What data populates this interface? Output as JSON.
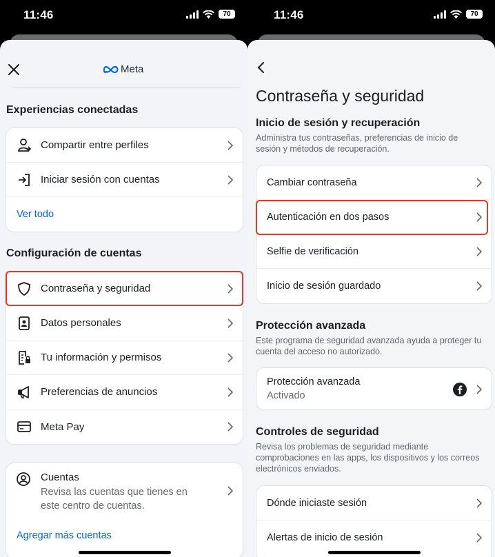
{
  "status": {
    "time": "11:46",
    "battery": "70"
  },
  "left": {
    "brand": "Meta",
    "connected": {
      "title": "Experiencias conectadas",
      "items": [
        {
          "label": "Compartir entre perfiles",
          "icon": "share-profiles-icon"
        },
        {
          "label": "Iniciar sesión con cuentas",
          "icon": "login-arrow-icon"
        }
      ],
      "see_all": "Ver todo"
    },
    "account_settings": {
      "title": "Configuración de cuentas",
      "items": [
        {
          "label": "Contraseña y seguridad",
          "icon": "shield-icon"
        },
        {
          "label": "Datos personales",
          "icon": "id-card-icon"
        },
        {
          "label": "Tu información y permisos",
          "icon": "document-lock-icon"
        },
        {
          "label": "Preferencias de anuncios",
          "icon": "megaphone-icon"
        },
        {
          "label": "Meta Pay",
          "icon": "credit-card-icon"
        }
      ]
    },
    "accounts": {
      "title": "Cuentas",
      "description_line1": "Revisa las cuentas que tienes en",
      "description_line2": "este centro de cuentas.",
      "add_link": "Agregar más cuentas"
    }
  },
  "right": {
    "page_title": "Contraseña y seguridad",
    "login_recovery": {
      "title": "Inicio de sesión y recuperación",
      "desc_line1": "Administra tus contraseñas, preferencias de inicio de",
      "desc_line2": "sesión y métodos de recuperación.",
      "items": [
        "Cambiar contraseña",
        "Autenticación en dos pasos",
        "Selfie de verificación",
        "Inicio de sesión guardado"
      ]
    },
    "advanced": {
      "title": "Protección avanzada",
      "desc_line1": "Este programa de seguridad avanzada ayuda a proteger tu",
      "desc_line2": "cuenta del acceso no autorizado.",
      "item_label": "Protección avanzada",
      "item_status": "Activado"
    },
    "security_controls": {
      "title": "Controles de seguridad",
      "desc_line1": "Revisa los problemas de seguridad mediante",
      "desc_line2": "comprobaciones en las apps, los dispositivos y los correos",
      "desc_line3": "electrónicos enviados.",
      "items": [
        "Dónde iniciaste sesión",
        "Alertas de inicio de sesión"
      ]
    }
  },
  "colors": {
    "link": "#0064e0",
    "highlight": "#e03a2c",
    "sheet": "#f2f4f7"
  }
}
